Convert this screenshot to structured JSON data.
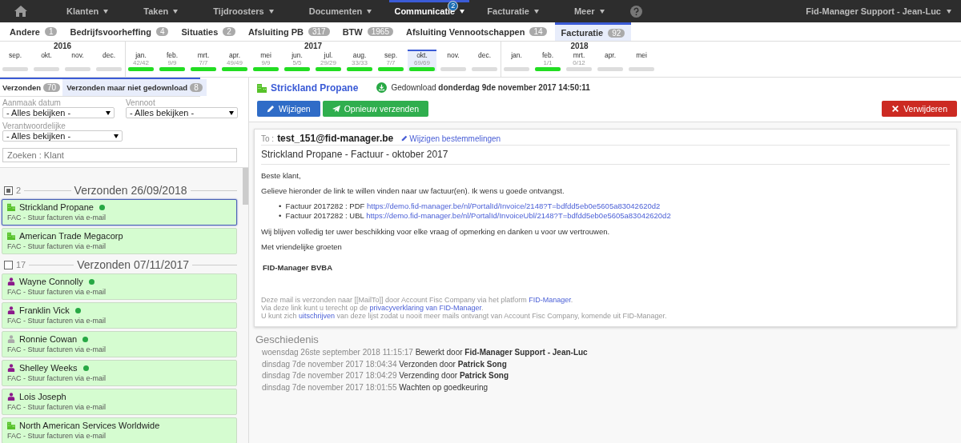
{
  "nav": {
    "items": [
      {
        "label": "Klanten",
        "selected": false
      },
      {
        "label": "Taken",
        "selected": false
      },
      {
        "label": "Tijdroosters",
        "selected": false
      },
      {
        "label": "Documenten",
        "selected": false
      },
      {
        "label": "Communicatie",
        "selected": true,
        "badge": "2"
      },
      {
        "label": "Facturatie",
        "selected": false
      },
      {
        "label": "Meer",
        "selected": false
      }
    ],
    "user": "Fid-Manager Support - Jean-Luc"
  },
  "categories": [
    {
      "label": "Andere",
      "count": "1",
      "selected": false
    },
    {
      "label": "Bedrijfsvoorheffing",
      "count": "4",
      "selected": false
    },
    {
      "label": "Situaties",
      "count": "2",
      "selected": false
    },
    {
      "label": "Afsluiting PB",
      "count": "317",
      "selected": false
    },
    {
      "label": "BTW",
      "count": "1965",
      "selected": false
    },
    {
      "label": "Afsluiting Vennootschappen",
      "count": "14",
      "selected": false
    },
    {
      "label": "Facturatie",
      "count": "92",
      "selected": true
    }
  ],
  "timeline": [
    {
      "year": "2016",
      "months": [
        {
          "label": "sep.",
          "done": false,
          "selected": false
        },
        {
          "label": "okt.",
          "done": false,
          "selected": false
        },
        {
          "label": "nov.",
          "done": false,
          "selected": false
        },
        {
          "label": "dec.",
          "done": false,
          "selected": false
        }
      ]
    },
    {
      "year": "2017",
      "months": [
        {
          "label": "jan.",
          "count": "42/42",
          "done": true,
          "selected": false
        },
        {
          "label": "feb.",
          "count": "9/9",
          "done": true,
          "selected": false
        },
        {
          "label": "mrt.",
          "count": "7/7",
          "done": true,
          "selected": false
        },
        {
          "label": "apr.",
          "count": "49/49",
          "done": true,
          "selected": false
        },
        {
          "label": "mei",
          "count": "9/9",
          "done": true,
          "selected": false
        },
        {
          "label": "jun.",
          "count": "5/5",
          "done": true,
          "selected": false
        },
        {
          "label": "jul.",
          "count": "29/29",
          "done": true,
          "selected": false
        },
        {
          "label": "aug.",
          "count": "33/33",
          "done": true,
          "selected": false
        },
        {
          "label": "sep.",
          "count": "7/7",
          "done": true,
          "selected": false
        },
        {
          "label": "okt.",
          "count": "69/69",
          "done": true,
          "selected": true
        },
        {
          "label": "nov.",
          "done": false,
          "selected": false
        },
        {
          "label": "dec.",
          "done": false,
          "selected": false
        }
      ]
    },
    {
      "year": "2018",
      "months": [
        {
          "label": "jan.",
          "done": false,
          "selected": false
        },
        {
          "label": "feb.",
          "count": "1/1",
          "done": true,
          "selected": false
        },
        {
          "label": "mrt.",
          "count": "0/12",
          "done": false,
          "selected": false
        },
        {
          "label": "apr.",
          "done": false,
          "selected": false
        },
        {
          "label": "mei",
          "done": false,
          "selected": false
        }
      ]
    }
  ],
  "subtabs": [
    {
      "label": "Verzonden",
      "count": "70",
      "selected": false
    },
    {
      "label": "Verzonden maar niet gedownload",
      "count": "8",
      "selected": true
    }
  ],
  "filters": [
    {
      "label": "Aanmaak datum",
      "value": "- Alles bekijken -"
    },
    {
      "label": "Vennoot",
      "value": "- Alles bekijken -"
    },
    {
      "label": "Verantwoordelijke",
      "value": "- Alles bekijken -"
    }
  ],
  "search": {
    "placeholder": "Zoeken : Klant"
  },
  "groups": [
    {
      "checked": true,
      "count": "2",
      "title": "Verzonden 26/09/2018",
      "items": [
        {
          "kind": "company",
          "name": "Strickland Propane",
          "subtitle": "FAC - Stuur facturen via e-mail",
          "downloaded": true,
          "selected": true
        },
        {
          "kind": "company",
          "name": "American Trade Megacorp",
          "subtitle": "FAC - Stuur facturen via e-mail",
          "downloaded": false,
          "selected": false
        }
      ]
    },
    {
      "checked": false,
      "count": "17",
      "title": "Verzonden 07/11/2017",
      "items": [
        {
          "kind": "person",
          "name": "Wayne Connolly",
          "subtitle": "FAC - Stuur facturen via e-mail",
          "downloaded": true,
          "inactive": false,
          "selected": false
        },
        {
          "kind": "person",
          "name": "Franklin Vick",
          "subtitle": "FAC - Stuur facturen via e-mail",
          "downloaded": true,
          "inactive": false,
          "selected": false
        },
        {
          "kind": "person",
          "name": "Ronnie Cowan",
          "subtitle": "FAC - Stuur facturen via e-mail",
          "downloaded": true,
          "inactive": true,
          "selected": false
        },
        {
          "kind": "person",
          "name": "Shelley Weeks",
          "subtitle": "FAC - Stuur facturen via e-mail",
          "downloaded": true,
          "inactive": false,
          "selected": false
        },
        {
          "kind": "person",
          "name": "Lois Joseph",
          "subtitle": "FAC - Stuur facturen via e-mail",
          "downloaded": false,
          "inactive": false,
          "selected": false
        },
        {
          "kind": "company",
          "name": "North American Services Worldwide",
          "subtitle": "FAC - Stuur facturen via e-mail",
          "downloaded": false,
          "selected": false
        }
      ]
    }
  ],
  "detail": {
    "client": "Strickland Propane",
    "status": "Gedownload **donderdag 9de november 2017 14:50:11**",
    "buttons": [
      {
        "kind": "primary",
        "label": "Wijzigen"
      },
      {
        "kind": "success",
        "label": "Opnieuw verzenden"
      },
      {
        "kind": "danger",
        "label": "Verwijderen"
      }
    ],
    "email": {
      "to_label": "To :",
      "to": "test_151@fid-manager.be",
      "edit_recipients": "Wijzigen bestemmelingen",
      "subject": "Strickland Propane - Factuur - oktober 2017",
      "greeting": "Beste klant,",
      "intro": "Gelieve hieronder de link te willen vinden naar uw factuur(en). Ik wens u goede ontvangst.",
      "invoices": [
        {
          "bullet": "•",
          "label": "Factuur 2017282 : PDF",
          "url": "https://demo.fid-manager.be/nl/PortalId/Invoice/2148?T=bdfdd5eb0e5605a83042620d2"
        },
        {
          "bullet": "•",
          "label": "Factuur 2017282 : UBL",
          "url": "https://demo.fid-manager.be/nl/PortalId/InvoiceUbl/2148?T=bdfdd5eb0e5605a83042620d2"
        }
      ],
      "closing": "Wij blijven volledig ter uwer beschikking voor elke vraag of opmerking en danken u voor uw vertrouwen.",
      "regards": "Met vriendelijke groeten",
      "signature": "FID-Manager BVBA",
      "footer": [
        {
          "before": "Deze mail is verzonden naar [[MailTo]] door Account Fisc Company via het platform",
          "link": "FID-Manager",
          "after": "."
        },
        {
          "before": "Via deze link kunt u terecht op de",
          "link": "privacyverklaring van FID-Manager",
          "after": "."
        },
        {
          "before": "U kunt zich",
          "link": "uitschrijven",
          "after": "van deze lijst zodat u nooit meer mails ontvangt van Account Fisc Company, komende uit FID-Manager."
        }
      ]
    },
    "history_title": "Geschiedenis",
    "history": [
      {
        "date": "woensdag 26ste september 2018 11:15:17",
        "action": "Bewerkt door **Fid-Manager Support - Jean-Luc**"
      },
      {
        "date": "dinsdag 7de november 2017 18:04:34",
        "action": "Verzonden door **Patrick Song**"
      },
      {
        "date": "dinsdag 7de november 2017 18:04:29",
        "action": "Verzending door **Patrick Song**"
      },
      {
        "date": "dinsdag 7de november 2017 18:01:55",
        "action": "Wachten op goedkeuring"
      }
    ]
  }
}
